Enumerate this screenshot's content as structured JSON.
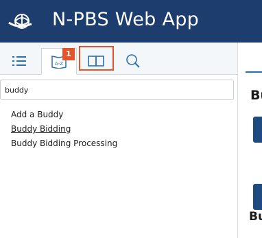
{
  "header": {
    "app_title": "N-PBS Web App",
    "logo_icon": "globe-logo-icon",
    "background_color": "#1c3d6e"
  },
  "help_panel": {
    "tabs": [
      {
        "name": "contents",
        "icon": "list-icon",
        "active": false
      },
      {
        "name": "index",
        "icon": "a-z-index-icon",
        "icon_text": "A-Z",
        "active": true
      },
      {
        "name": "glossary",
        "icon": "open-book-icon",
        "active": false,
        "highlighted": true
      },
      {
        "name": "search",
        "icon": "magnifier-icon",
        "active": false
      }
    ],
    "callout_badge": "1",
    "search": {
      "value": "buddy",
      "placeholder": ""
    },
    "results": [
      {
        "label": "Add a Buddy",
        "underlined": false
      },
      {
        "label": "Buddy Bidding",
        "underlined": true
      },
      {
        "label": "Buddy Bidding Processing",
        "underlined": false
      }
    ]
  },
  "content_area": {
    "heading_fragment": "Bu",
    "heading2_fragment": "Bu"
  },
  "colors": {
    "accent_orange": "#e8542a",
    "brand_navy": "#1c3d6e",
    "button_blue": "#1f4c80"
  }
}
